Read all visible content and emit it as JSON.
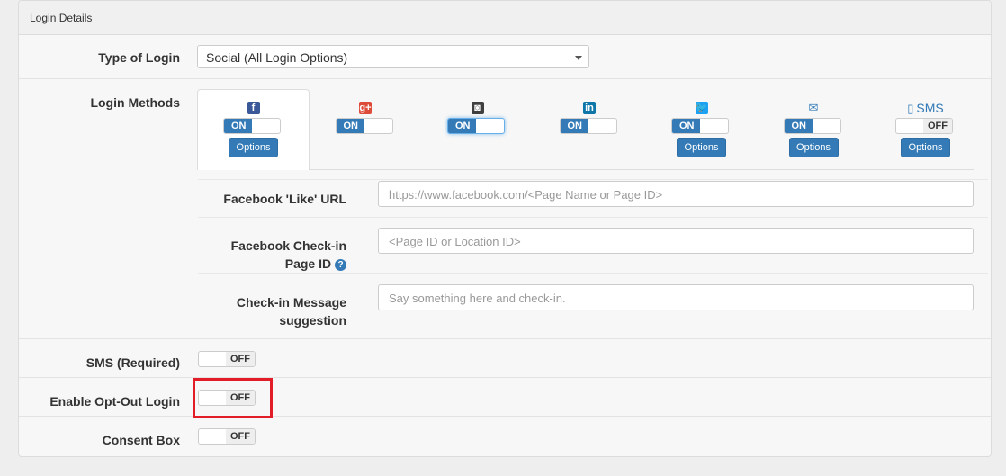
{
  "panel_title": "Login Details",
  "type_of_login": {
    "label": "Type of Login",
    "value": "Social (All Login Options)"
  },
  "login_methods": {
    "label": "Login Methods",
    "methods": [
      {
        "name": "facebook",
        "icon": "facebook-icon",
        "icon_char": "f",
        "color": "#3b5998",
        "state": "ON",
        "has_options": true,
        "options_label": "Options"
      },
      {
        "name": "google-plus",
        "icon": "google-plus-icon",
        "icon_char": "g+",
        "color": "#dd4b39",
        "state": "ON",
        "has_options": false
      },
      {
        "name": "instagram",
        "icon": "instagram-icon",
        "icon_char": "◙",
        "color": "#3f3f3f",
        "state": "ON",
        "has_options": false
      },
      {
        "name": "linkedin",
        "icon": "linkedin-icon",
        "icon_char": "in",
        "color": "#0e76a8",
        "state": "ON",
        "has_options": false
      },
      {
        "name": "twitter",
        "icon": "twitter-icon",
        "icon_char": "🐦",
        "color": "#1da1f2",
        "state": "ON",
        "has_options": true,
        "options_label": "Options"
      },
      {
        "name": "email",
        "icon": "envelope-icon",
        "icon_char": "✉",
        "color": "#337ab7",
        "state": "ON",
        "has_options": true,
        "options_label": "Options"
      },
      {
        "name": "sms",
        "icon": "mobile-icon",
        "icon_char": "▯",
        "label": "SMS",
        "color": "#337ab7",
        "state": "OFF",
        "has_options": true,
        "options_label": "Options"
      }
    ]
  },
  "facebook_like_url": {
    "label": "Facebook 'Like' URL",
    "placeholder": "https://www.facebook.com/<Page Name or Page ID>"
  },
  "facebook_checkin": {
    "label_line1": "Facebook Check-in",
    "label_line2": "Page ID",
    "help_icon": "?",
    "placeholder": "<Page ID or Location ID>"
  },
  "checkin_message": {
    "label_line1": "Check-in Message",
    "label_line2": "suggestion",
    "placeholder": "Say something here and check-in."
  },
  "sms_required": {
    "label": "SMS (Required)",
    "state": "OFF"
  },
  "opt_out": {
    "label": "Enable Opt-Out Login",
    "state": "OFF"
  },
  "consent_box": {
    "label": "Consent Box",
    "state": "OFF"
  },
  "toggle_on_text": "ON",
  "toggle_off_text": "OFF",
  "colors": {
    "primary": "#337ab7",
    "highlight": "#e21d27"
  }
}
